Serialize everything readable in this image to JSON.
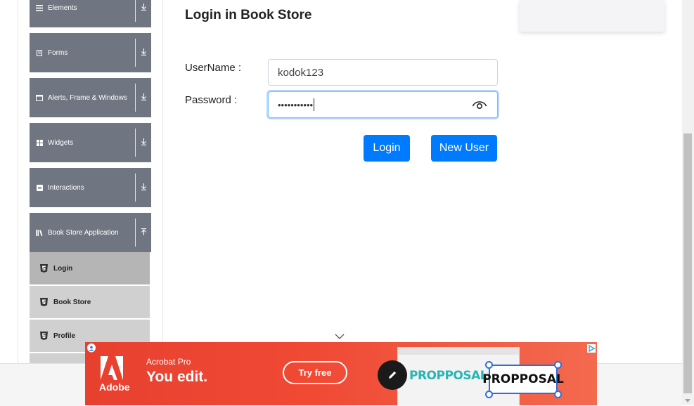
{
  "sidebar": {
    "groups": [
      {
        "label": "Elements",
        "icon": "hamburger-icon"
      },
      {
        "label": "Forms",
        "icon": "form-icon"
      },
      {
        "label": "Alerts, Frame & Windows",
        "icon": "window-icon"
      },
      {
        "label": "Widgets",
        "icon": "grid-icon"
      },
      {
        "label": "Interactions",
        "icon": "interactions-icon"
      },
      {
        "label": "Book Store Application",
        "icon": "library-icon"
      }
    ],
    "bookstore_items": [
      {
        "label": "Login",
        "icon": "html5-icon",
        "active": true
      },
      {
        "label": "Book Store",
        "icon": "html5-icon",
        "active": false
      },
      {
        "label": "Profile",
        "icon": "html5-icon",
        "active": false
      }
    ]
  },
  "main": {
    "title": "Login in Book Store",
    "username_label": "UserName :",
    "username_value": "kodok123",
    "password_label": "Password :",
    "password_masked": "•••••••••••",
    "login_button": "Login",
    "new_user_button": "New User"
  },
  "ad": {
    "brand": "Adobe",
    "product": "Acrobat Pro",
    "tagline": "You edit.",
    "cta": "Try free",
    "doc_text": "PROPPOSAL",
    "edit_text": "PROPPOSAL",
    "colors": {
      "background": "#e8402f",
      "accent": "#28b5b5"
    }
  },
  "colors": {
    "primary": "#007bff",
    "sidebar_header": "#707681",
    "submenu": "#d0d0d0"
  }
}
